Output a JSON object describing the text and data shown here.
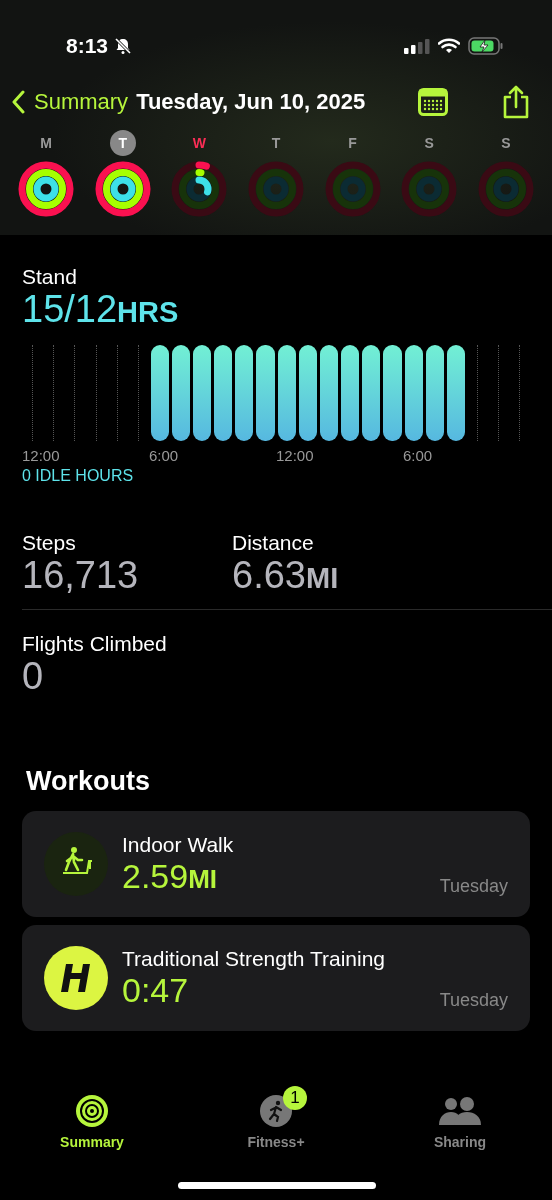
{
  "status_bar": {
    "time": "8:13",
    "silent": true
  },
  "nav": {
    "back": "Summary",
    "title": "Tuesday, Jun 10, 2025"
  },
  "week": [
    {
      "letter": "M",
      "selected": false,
      "today": false,
      "kind": "closed"
    },
    {
      "letter": "T",
      "selected": true,
      "today": false,
      "kind": "closed"
    },
    {
      "letter": "W",
      "selected": false,
      "today": true,
      "kind": "partial"
    },
    {
      "letter": "T",
      "selected": false,
      "today": false,
      "kind": "empty"
    },
    {
      "letter": "F",
      "selected": false,
      "today": false,
      "kind": "empty"
    },
    {
      "letter": "S",
      "selected": false,
      "today": false,
      "kind": "empty"
    },
    {
      "letter": "S",
      "selected": false,
      "today": false,
      "kind": "empty"
    }
  ],
  "stand": {
    "label": "Stand",
    "value": "15/12",
    "unit": "HRS",
    "hours": [
      {
        "stood": false
      },
      {
        "stood": false
      },
      {
        "stood": false
      },
      {
        "stood": false
      },
      {
        "stood": false
      },
      {
        "stood": false
      },
      {
        "stood": true
      },
      {
        "stood": true
      },
      {
        "stood": true
      },
      {
        "stood": true
      },
      {
        "stood": true
      },
      {
        "stood": true
      },
      {
        "stood": true
      },
      {
        "stood": true
      },
      {
        "stood": true
      },
      {
        "stood": true
      },
      {
        "stood": true
      },
      {
        "stood": true
      },
      {
        "stood": true
      },
      {
        "stood": true
      },
      {
        "stood": true
      },
      {
        "stood": false
      },
      {
        "stood": false
      },
      {
        "stood": false
      }
    ],
    "axis_labels": [
      "12:00",
      "6:00",
      "12:00",
      "6:00"
    ],
    "idle": "0 IDLE HOURS"
  },
  "steps": {
    "label": "Steps",
    "value": "16,713"
  },
  "distance": {
    "label": "Distance",
    "value": "6.63",
    "unit": "MI"
  },
  "flights": {
    "label": "Flights Climbed",
    "value": "0"
  },
  "workouts": {
    "heading": "Workouts",
    "items": [
      {
        "kind": "walk",
        "name": "Indoor Walk",
        "value": "2.59",
        "unit": "MI",
        "day": "Tuesday"
      },
      {
        "kind": "strength",
        "name": "Traditional Strength Training",
        "value": "0:47",
        "day": "Tuesday"
      }
    ]
  },
  "tabs": [
    {
      "kind": "summary",
      "label": "Summary",
      "selected": true
    },
    {
      "kind": "fitness",
      "label": "Fitness+",
      "selected": false,
      "badge": "1"
    },
    {
      "kind": "sharing",
      "label": "Sharing",
      "selected": false
    }
  ]
}
